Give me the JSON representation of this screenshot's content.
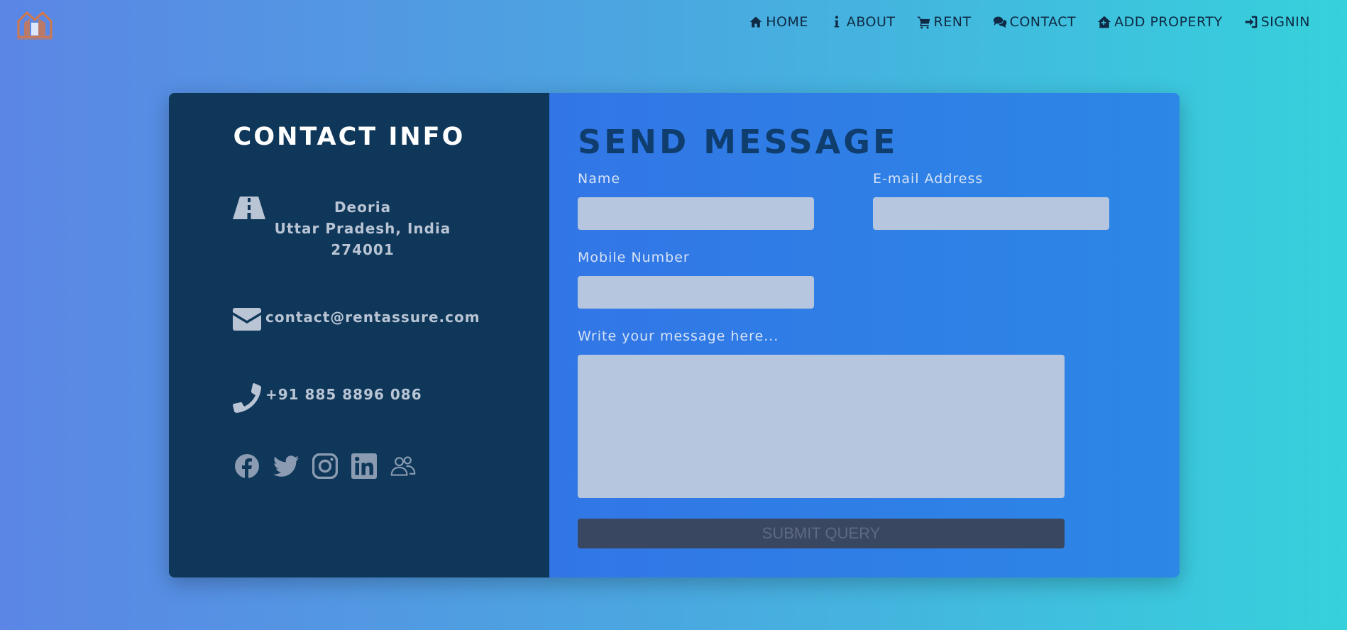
{
  "nav": {
    "items": [
      {
        "label": "HOME",
        "icon": "home-icon"
      },
      {
        "label": "ABOUT",
        "icon": "info-icon"
      },
      {
        "label": "RENT",
        "icon": "cart-icon"
      },
      {
        "label": "CONTACT",
        "icon": "comments-icon"
      },
      {
        "label": "ADD PROPERTY",
        "icon": "house-add-icon"
      },
      {
        "label": "SIGNIN",
        "icon": "sign-in-icon"
      }
    ]
  },
  "contact_info": {
    "title": "CONTACT INFO",
    "address": {
      "line1": "Deoria",
      "line2": "Uttar Pradesh, India",
      "line3": "274001"
    },
    "email": "contact@rentassure.com",
    "phone": "+91 885 8896 086",
    "socials": [
      "facebook-icon",
      "twitter-icon",
      "instagram-icon",
      "linkedin-icon",
      "people-icon"
    ]
  },
  "form": {
    "title": "SEND MESSAGE",
    "name_label": "Name",
    "email_label": "E-mail Address",
    "mobile_label": "Mobile Number",
    "message_label": "Write your message here...",
    "name_value": "",
    "email_value": "",
    "mobile_value": "",
    "message_value": "",
    "submit_label": "SUBMIT QUERY"
  },
  "colors": {
    "left_panel": "#0f3759",
    "right_panel": "#3276e6",
    "accent_title": "#0f3d6e",
    "input_bg": "#b6c6de",
    "button_bg": "#3a4760"
  }
}
